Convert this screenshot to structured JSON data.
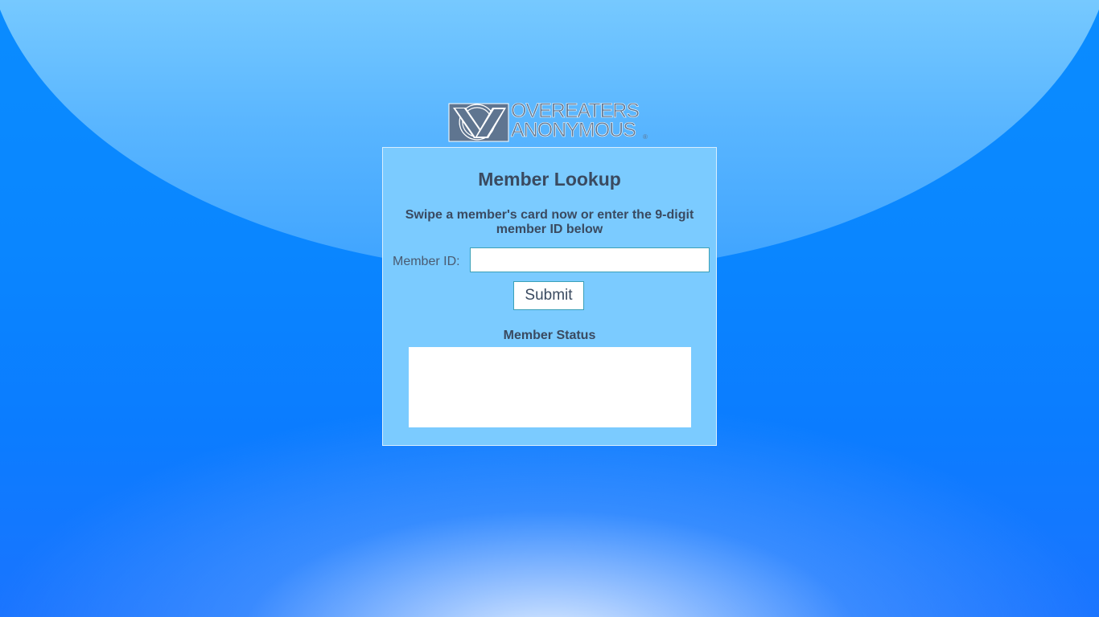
{
  "logo": {
    "line1": "OVEREATERS",
    "line2": "ANONYMOUS",
    "registered": "®",
    "icon": "oa-logo-icon"
  },
  "lookup": {
    "title": "Member Lookup",
    "instructions": "Swipe a member's card now or enter the 9-digit member ID below",
    "member_id_label": "Member ID:",
    "member_id_value": "",
    "submit_label": "Submit",
    "status_label": "Member Status",
    "status_text": ""
  },
  "colors": {
    "background": "#0a86ff",
    "panel": "#7bcbff",
    "text": "#3a4a60",
    "logo": "#5f7590",
    "input_border": "#3aa0b8"
  }
}
